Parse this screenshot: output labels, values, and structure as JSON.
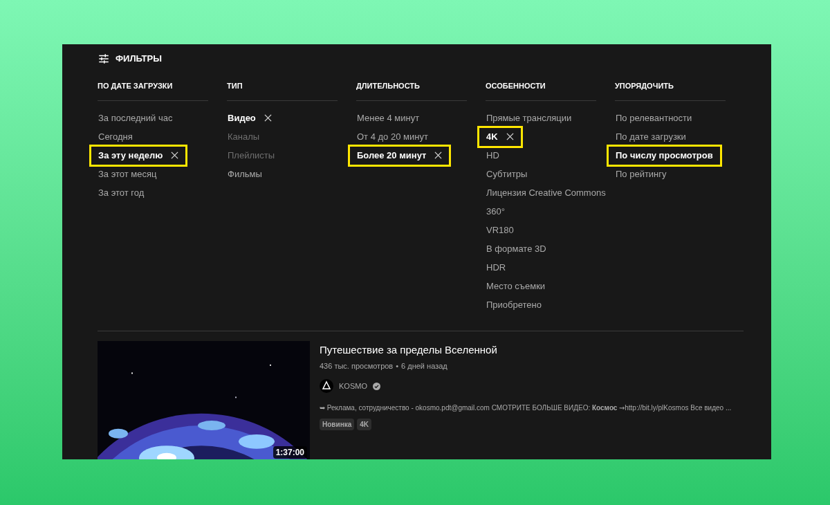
{
  "header": {
    "title": "ФИЛЬТРЫ"
  },
  "columns": [
    {
      "kind": "filter",
      "heading": "ПО ДАТЕ ЗАГРУЗКИ",
      "items": [
        {
          "label": "За последний час",
          "selected": false,
          "disabled": false,
          "highlighted": false
        },
        {
          "label": "Сегодня",
          "selected": false,
          "disabled": false,
          "highlighted": false
        },
        {
          "label": "За эту неделю",
          "selected": true,
          "disabled": false,
          "highlighted": true
        },
        {
          "label": "За этот месяц",
          "selected": false,
          "disabled": false,
          "highlighted": false
        },
        {
          "label": "За этот год",
          "selected": false,
          "disabled": false,
          "highlighted": false
        }
      ]
    },
    {
      "kind": "filter",
      "heading": "ТИП",
      "items": [
        {
          "label": "Видео",
          "selected": true,
          "disabled": false,
          "highlighted": false
        },
        {
          "label": "Каналы",
          "selected": false,
          "disabled": true,
          "highlighted": false
        },
        {
          "label": "Плейлисты",
          "selected": false,
          "disabled": true,
          "highlighted": false
        },
        {
          "label": "Фильмы",
          "selected": false,
          "disabled": false,
          "highlighted": false
        }
      ]
    },
    {
      "kind": "filter",
      "heading": "ДЛИТЕЛЬНОСТЬ",
      "items": [
        {
          "label": "Менее 4 минут",
          "selected": false,
          "disabled": false,
          "highlighted": false
        },
        {
          "label": "От 4 до 20 минут",
          "selected": false,
          "disabled": false,
          "highlighted": false
        },
        {
          "label": "Более 20 минут",
          "selected": true,
          "disabled": false,
          "highlighted": true
        }
      ]
    },
    {
      "kind": "filter",
      "heading": "ОСОБЕННОСТИ",
      "items": [
        {
          "label": "Прямые трансляции",
          "selected": false,
          "disabled": false,
          "highlighted": false
        },
        {
          "label": "4K",
          "selected": true,
          "disabled": false,
          "highlighted": true
        },
        {
          "label": "HD",
          "selected": false,
          "disabled": false,
          "highlighted": false
        },
        {
          "label": "Субтитры",
          "selected": false,
          "disabled": false,
          "highlighted": false
        },
        {
          "label": "Лицензия Creative Commons",
          "selected": false,
          "disabled": false,
          "highlighted": false
        },
        {
          "label": "360°",
          "selected": false,
          "disabled": false,
          "highlighted": false
        },
        {
          "label": "VR180",
          "selected": false,
          "disabled": false,
          "highlighted": false
        },
        {
          "label": "В формате 3D",
          "selected": false,
          "disabled": false,
          "highlighted": false
        },
        {
          "label": "HDR",
          "selected": false,
          "disabled": false,
          "highlighted": false
        },
        {
          "label": "Место съемки",
          "selected": false,
          "disabled": false,
          "highlighted": false
        },
        {
          "label": "Приобретено",
          "selected": false,
          "disabled": false,
          "highlighted": false
        }
      ]
    },
    {
      "kind": "sort",
      "heading": "УПОРЯДОЧИТЬ",
      "items": [
        {
          "label": "По релевантности",
          "selected": false,
          "disabled": false,
          "highlighted": false
        },
        {
          "label": "По дате загрузки",
          "selected": false,
          "disabled": false,
          "highlighted": false
        },
        {
          "label": "По числу просмотров",
          "selected": true,
          "disabled": false,
          "highlighted": true
        },
        {
          "label": "По рейтингу",
          "selected": false,
          "disabled": false,
          "highlighted": false
        }
      ]
    }
  ],
  "video": {
    "thumbnail": {
      "kind": "picture",
      "duration": "1:37:00"
    },
    "title": "Путешествие за пределы Вселенной",
    "views": "436 тыс. просмотров",
    "separator": "•",
    "age": "6 дней назад",
    "channel": {
      "name": "KOSMO",
      "verified": true
    },
    "description": "➥ Реклама, сотрудничество - okosmo.pdt@gmail.com СМОТРИТЕ БОЛЬШЕ ВИДЕО: **Космос** ⇝http://bit.ly/plKosmos Все видео ...",
    "badges": [
      "Новинка",
      "4K"
    ]
  }
}
